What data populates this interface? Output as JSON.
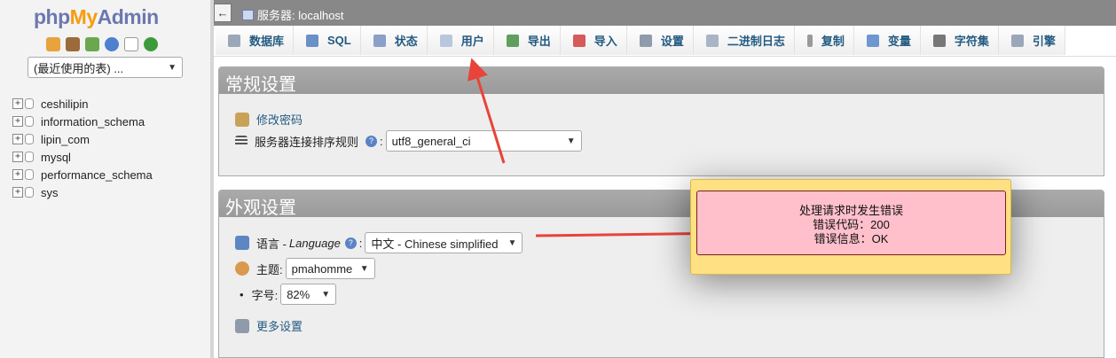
{
  "logo": {
    "php": "php",
    "my": "My",
    "admin": "Admin"
  },
  "nav": {
    "icons": [
      "home-icon",
      "exit-icon",
      "docs-icon",
      "help-icon",
      "copy-icon",
      "reload-icon"
    ],
    "recent_select": "(最近使用的表) ...",
    "databases": [
      "ceshilipin",
      "information_schema",
      "lipin_com",
      "mysql",
      "performance_schema",
      "sys"
    ]
  },
  "serverbar": {
    "back": "←",
    "label": "服务器: localhost"
  },
  "tabs": [
    {
      "label": "数据库",
      "icon": "database-icon",
      "color": "#9aa7b9"
    },
    {
      "label": "SQL",
      "icon": "sql-icon",
      "color": "#6b8fc7"
    },
    {
      "label": "状态",
      "icon": "status-icon",
      "color": "#8aa0c9"
    },
    {
      "label": "用户",
      "icon": "users-icon",
      "color": "#b9c6dd"
    },
    {
      "label": "导出",
      "icon": "export-icon",
      "color": "#5fa05f"
    },
    {
      "label": "导入",
      "icon": "import-icon",
      "color": "#d65a5a"
    },
    {
      "label": "设置",
      "icon": "wrench-icon",
      "color": "#8f9aab"
    },
    {
      "label": "二进制日志",
      "icon": "binlog-icon",
      "color": "#a9b4c5"
    },
    {
      "label": "复制",
      "icon": "replication-icon",
      "color": "#9a9a9a"
    },
    {
      "label": "变量",
      "icon": "variables-icon",
      "color": "#6f97cf"
    },
    {
      "label": "字符集",
      "icon": "charset-icon",
      "color": "#777777"
    },
    {
      "label": "引擎",
      "icon": "engine-icon",
      "color": "#9aa7b9"
    }
  ],
  "general": {
    "title": "常规设置",
    "change_password": "修改密码",
    "collation_label": "服务器连接排序规则",
    "collation_value": "utf8_general_ci"
  },
  "appearance": {
    "title": "外观设置",
    "language_label": "语言 - ",
    "language_label_en": "Language",
    "language_value": "中文 - Chinese simplified",
    "theme_label": "主题:",
    "theme_value": "pmahomme",
    "fontsize_label": "字号:",
    "fontsize_value": "82%",
    "more_settings": "更多设置"
  },
  "error": {
    "title": "处理请求时发生错误",
    "code": "错误代码：200",
    "message": "错误信息：OK"
  },
  "colors": {
    "accent": "#235a81",
    "arrow": "#e8443a",
    "error_bg": "#ffc0cb",
    "popup_bg": "#ffe082"
  }
}
